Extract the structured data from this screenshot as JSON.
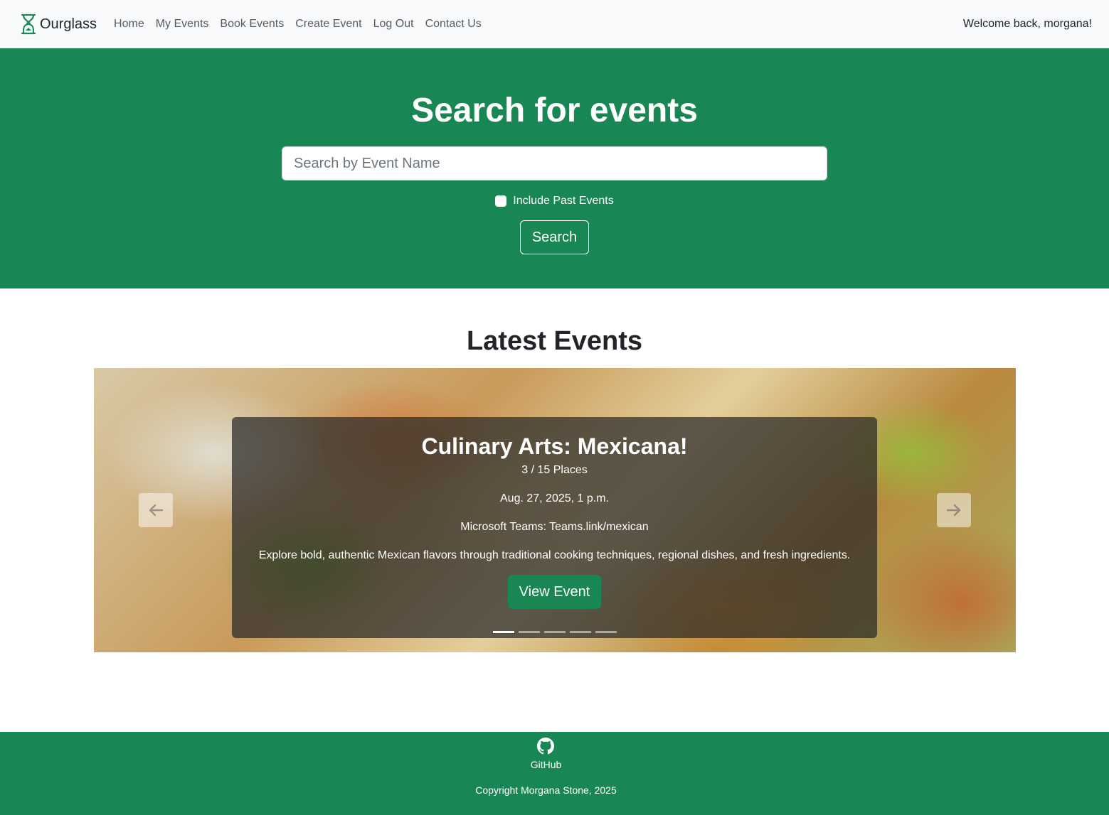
{
  "navbar": {
    "brand": "Ourglass",
    "links": [
      {
        "label": "Home"
      },
      {
        "label": "My Events"
      },
      {
        "label": "Book Events"
      },
      {
        "label": "Create Event"
      },
      {
        "label": "Log Out"
      },
      {
        "label": "Contact Us"
      }
    ],
    "welcome": "Welcome back, morgana!"
  },
  "hero": {
    "title": "Search for events",
    "search_placeholder": "Search by Event Name",
    "search_value": "",
    "include_past_label": "Include Past Events",
    "include_past_checked": false,
    "search_button": "Search"
  },
  "latest": {
    "title": "Latest Events",
    "slides_count": 5,
    "active_slide": 1,
    "current": {
      "title": "Culinary Arts: Mexicana!",
      "places": "3 / 15 Places",
      "datetime": "Aug. 27, 2025, 1 p.m.",
      "location": "Microsoft Teams: Teams.link/mexican",
      "description": "Explore bold, authentic Mexican flavors through traditional cooking techniques, regional dishes, and fresh ingredients.",
      "button": "View Event"
    }
  },
  "footer": {
    "github_label": "GitHub",
    "copyright": "Copyright Morgana Stone, 2025"
  },
  "colors": {
    "primary": "#198754",
    "navbar_bg": "#f8f9fa"
  }
}
